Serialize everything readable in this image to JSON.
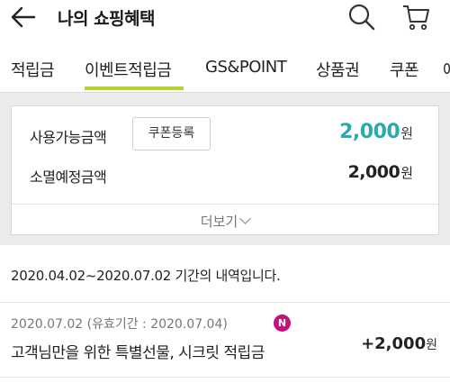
{
  "header": {
    "title": "나의 쇼핑혜택",
    "back_icon": "arrow-left-icon",
    "search_icon": "search-icon",
    "cart_icon": "cart-icon"
  },
  "tabs": [
    {
      "label": "적립금",
      "active": false
    },
    {
      "label": "이벤트적립금",
      "active": true
    },
    {
      "label": "GS&POINT",
      "active": false
    },
    {
      "label": "상품권",
      "active": false
    },
    {
      "label": "쿠폰",
      "active": false
    },
    {
      "label": "에",
      "active": false
    }
  ],
  "summary": {
    "available_label": "사용가능금액",
    "coupon_button": "쿠폰등록",
    "available_amount": "2,000",
    "available_unit": "원",
    "expiring_label": "소멸예정금액",
    "expiring_amount": "2,000",
    "expiring_unit": "원",
    "more_label": "더보기"
  },
  "period_text": "2020.04.02~2020.07.02 기간의 내역입니다.",
  "history": [
    {
      "date": "2020.07.02 (유효기간 : 2020.07.04)",
      "badge": "N",
      "title": "고객님만을 위한 특별선물, 시크릿 적립금",
      "amount": "+2,000",
      "unit": "원"
    }
  ],
  "colors": {
    "accent_teal": "#2aa9b1",
    "tab_underline": "#b5d334",
    "badge": "#c4127c"
  }
}
